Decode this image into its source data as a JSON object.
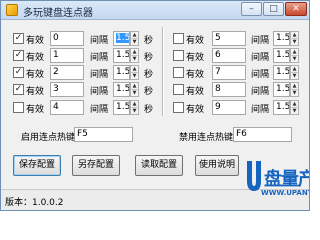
{
  "window": {
    "title": "多玩键盘连点器"
  },
  "titlebar_buttons": {
    "minimize": "–",
    "maximize": "□",
    "close": "✕"
  },
  "labels": {
    "enabled": "有效",
    "interval": "间隔",
    "seconds": "秒"
  },
  "left_rows": [
    {
      "checked": true,
      "key": "0",
      "interval": "1.5",
      "interval_selected": true
    },
    {
      "checked": true,
      "key": "1",
      "interval": "1.5"
    },
    {
      "checked": true,
      "key": "2",
      "interval": "1.5"
    },
    {
      "checked": true,
      "key": "3",
      "interval": "1.5"
    },
    {
      "checked": false,
      "key": "4",
      "interval": "1.5"
    }
  ],
  "right_rows": [
    {
      "checked": false,
      "key": "5",
      "interval": "1.5"
    },
    {
      "checked": false,
      "key": "6",
      "interval": "1.5"
    },
    {
      "checked": false,
      "key": "7",
      "interval": "1.5"
    },
    {
      "checked": false,
      "key": "8",
      "interval": "1.5"
    },
    {
      "checked": false,
      "key": "9",
      "interval": "1.5"
    }
  ],
  "hotkeys": {
    "enable_label": "启用连点热键",
    "enable_value": "F5",
    "disable_label": "禁用连点热键",
    "disable_value": "F6"
  },
  "buttons": {
    "save": "保存配置",
    "save_as": "另存配置",
    "load": "读取配置",
    "help": "使用说明"
  },
  "status": {
    "version": "版本：1.0.0.2"
  },
  "watermark": {
    "brand": "盘量产网",
    "url": "WWW.UPANTOOL.COM"
  },
  "colors": {
    "selection": "#3399ff",
    "watermark": "#1565c0"
  },
  "check_mark": "✓",
  "spin": {
    "up": "▲",
    "down": "▼"
  }
}
